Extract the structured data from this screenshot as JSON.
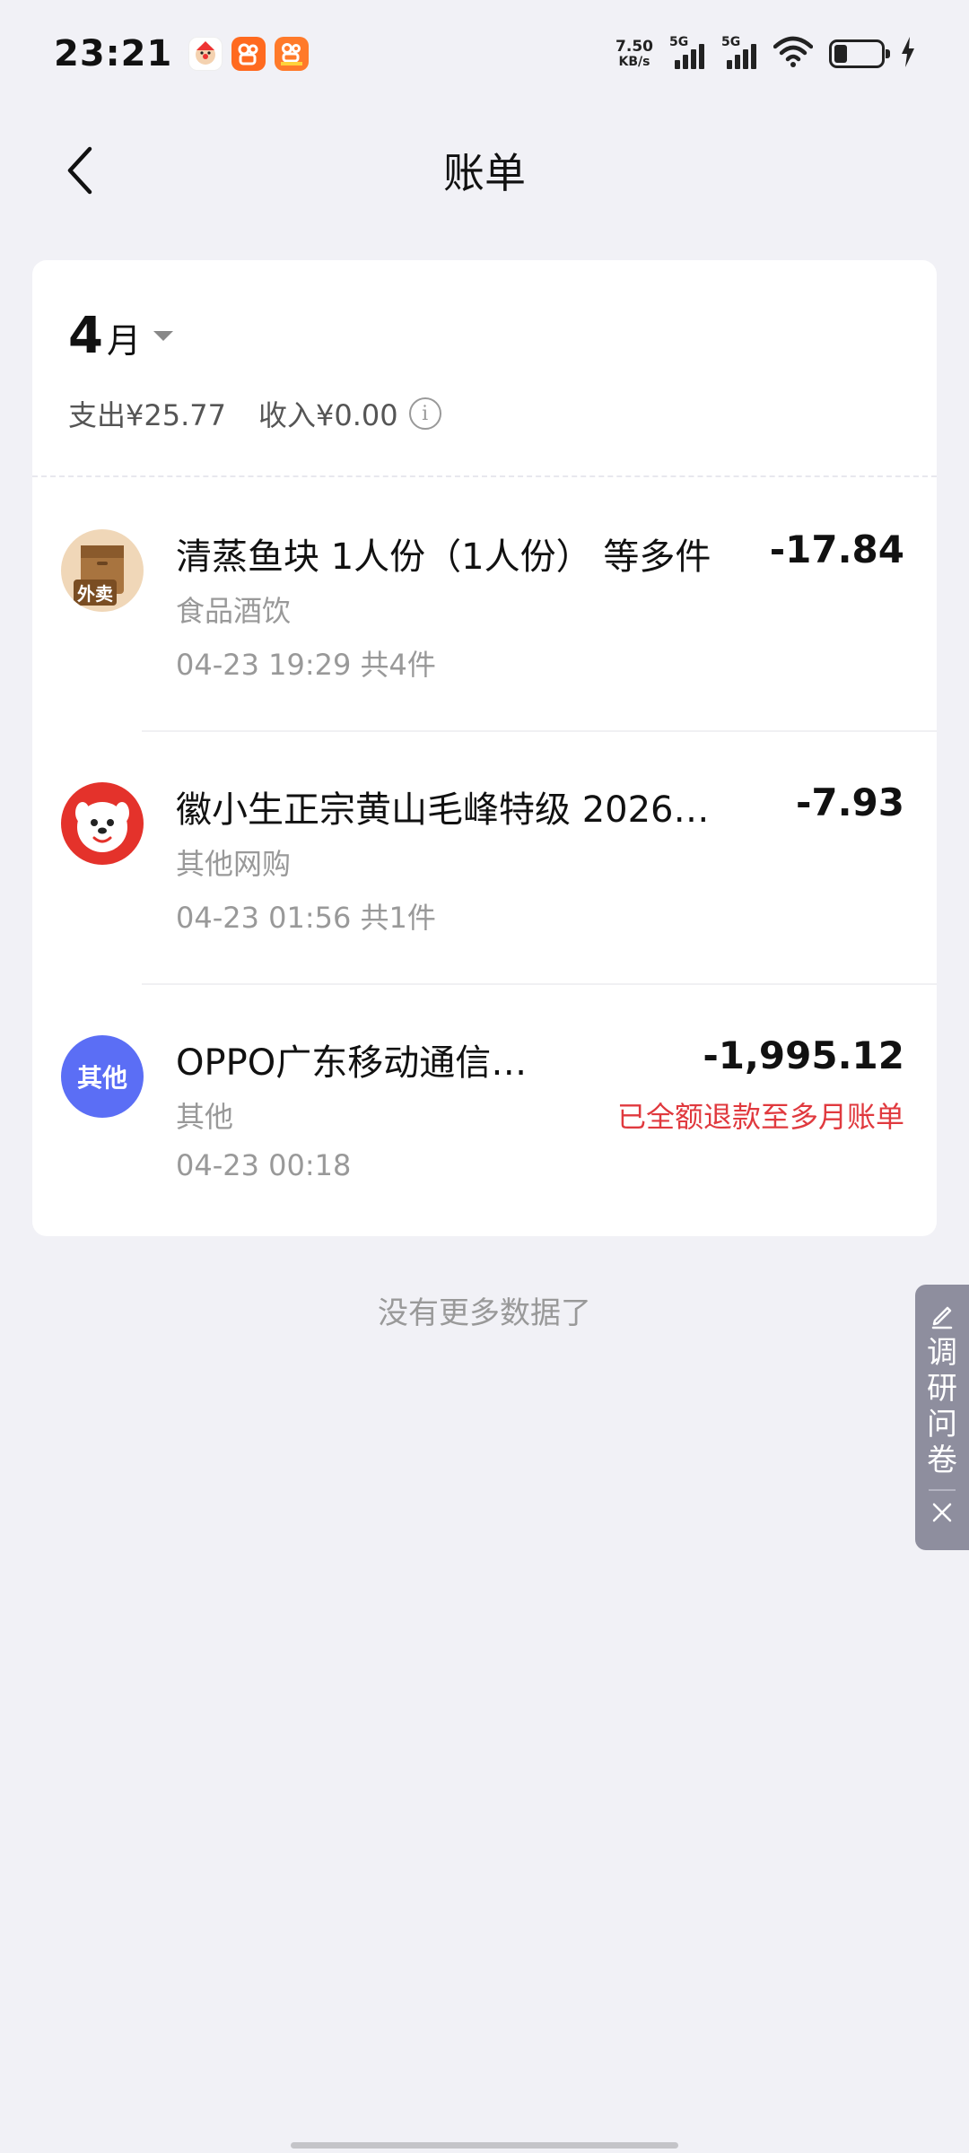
{
  "status_bar": {
    "time": "23:21",
    "net_speed_value": "7.50",
    "net_speed_unit": "KB/s",
    "signal_1": "5G",
    "signal_2": "5G",
    "battery_level": 0.28
  },
  "nav": {
    "title": "账单",
    "back_icon": "chevron-left-icon"
  },
  "summary": {
    "month_number": "4",
    "month_unit": "月",
    "expense": "支出¥25.77",
    "income": "收入¥0.00",
    "info_icon": "i"
  },
  "bills": [
    {
      "icon": "takeout-bag-icon",
      "icon_label": "外卖",
      "title": "清蒸鱼块 1人份（1人份） 等多件",
      "amount": "-17.84",
      "category": "食品酒饮",
      "time": "04-23 19:29 共4件",
      "note": ""
    },
    {
      "icon": "jd-mascot-icon",
      "icon_label": "",
      "title": "徽小生正宗黄山毛峰特级 2026…",
      "amount": "-7.93",
      "category": "其他网购",
      "time": "04-23 01:56 共1件",
      "note": ""
    },
    {
      "icon": "other-category-icon",
      "icon_label": "其他",
      "title": "OPPO广东移动通信…",
      "amount": "-1,995.12",
      "category": "其他",
      "time": "04-23 00:18",
      "note": "已全额退款至多月账单"
    }
  ],
  "footer": {
    "no_more": "没有更多数据了"
  },
  "survey": {
    "label": "调研问卷",
    "edit_icon": "pencil-icon",
    "close_icon": "close-icon"
  },
  "colors": {
    "background": "#f1f1f6",
    "refund_red": "#e0393e",
    "other_badge_blue": "#5b6ef5",
    "jd_red": "#e4322b",
    "takeout_brown": "#a8743f"
  }
}
